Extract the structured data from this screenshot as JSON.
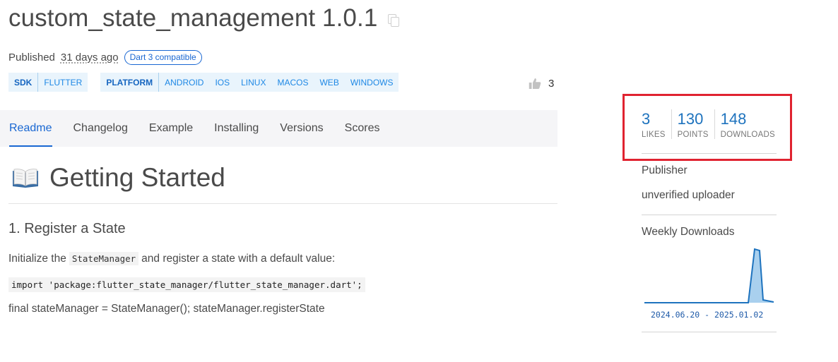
{
  "package": {
    "title": "custom_state_management 1.0.1",
    "published_label": "Published",
    "published_ago": "31 days ago",
    "dart_badge": "Dart 3 compatible"
  },
  "tags": {
    "sdk": {
      "head": "SDK",
      "items": [
        "FLUTTER"
      ]
    },
    "platform": {
      "head": "PLATFORM",
      "items": [
        "ANDROID",
        "IOS",
        "LINUX",
        "MACOS",
        "WEB",
        "WINDOWS"
      ]
    }
  },
  "likes_inline": "3",
  "tabs": [
    {
      "label": "Readme",
      "active": true
    },
    {
      "label": "Changelog"
    },
    {
      "label": "Example"
    },
    {
      "label": "Installing"
    },
    {
      "label": "Versions"
    },
    {
      "label": "Scores"
    }
  ],
  "readme": {
    "h1": "Getting Started",
    "h3": "1. Register a State",
    "para_before": "Initialize the",
    "para_code": "StateManager",
    "para_after": "and register a state with a default value:",
    "code_block": "import 'package:flutter_state_manager/flutter_state_manager.dart';",
    "para2": "final stateManager = StateManager(); stateManager.registerState"
  },
  "sidebar": {
    "stats": [
      {
        "value": "3",
        "label": "LIKES"
      },
      {
        "value": "130",
        "label": "POINTS"
      },
      {
        "value": "148",
        "label": "DOWNLOADS"
      }
    ],
    "publisher_label": "Publisher",
    "publisher_value": "unverified uploader",
    "weekly_label": "Weekly Downloads",
    "weekly_range": "2024.06.20 - 2025.01.02"
  },
  "colors": {
    "accent": "#1967d2",
    "highlight": "#e02330",
    "spark_line": "#1e73be",
    "spark_fill": "#a9d0ee"
  }
}
